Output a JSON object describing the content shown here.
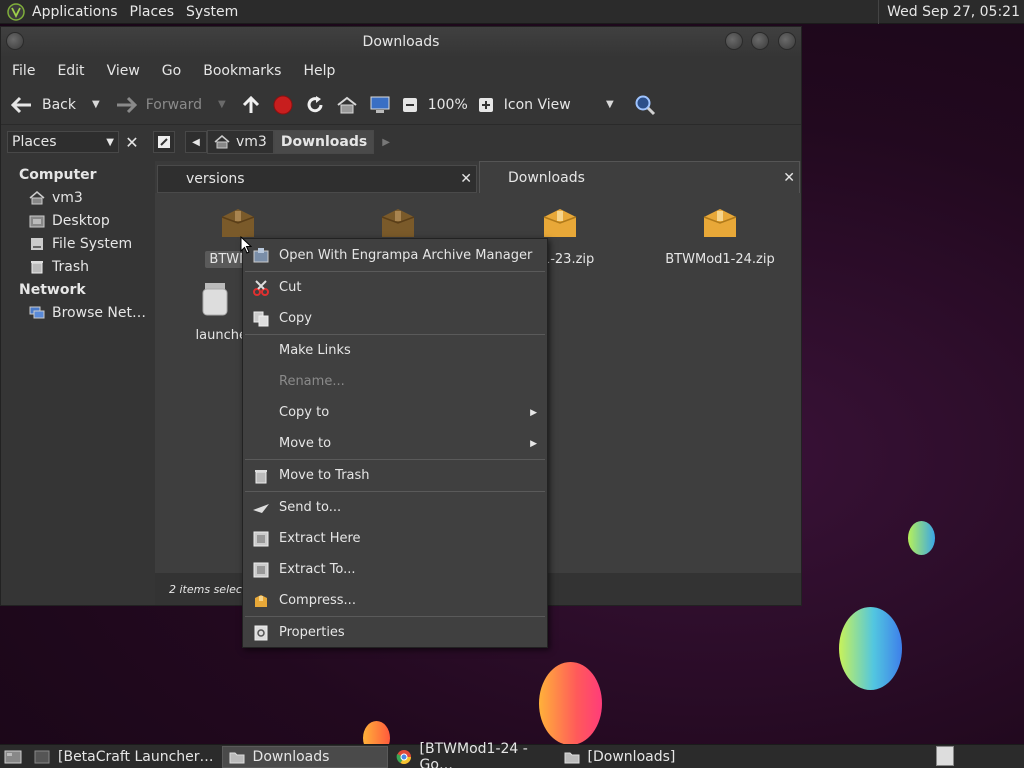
{
  "top_panel": {
    "menus": [
      "Applications",
      "Places",
      "System"
    ],
    "clock": "Wed Sep 27, 05:21"
  },
  "window": {
    "title": "Downloads",
    "menubar": [
      "File",
      "Edit",
      "View",
      "Go",
      "Bookmarks",
      "Help"
    ],
    "toolbar": {
      "back": "Back",
      "forward": "Forward",
      "zoom": "100%",
      "view_mode": "Icon View"
    },
    "location": {
      "places_label": "Places",
      "crumbs": [
        "vm3",
        "Downloads"
      ]
    },
    "sidebar": {
      "computer_header": "Computer",
      "computer_items": [
        "vm3",
        "Desktop",
        "File System",
        "Trash"
      ],
      "network_header": "Network",
      "network_items": [
        "Browse Net…"
      ]
    },
    "tabs": [
      "versions",
      "Downloads"
    ],
    "files": [
      {
        "label": "BTWMod"
      },
      {
        "label": ""
      },
      {
        "label": "od1-23.zip"
      },
      {
        "label": "BTWMod1-24.zip"
      },
      {
        "label": "launcher-1"
      }
    ],
    "status": "2 items selecte"
  },
  "context_menu": {
    "items": [
      {
        "label": "Open With Engrampa Archive Manager",
        "icon": "archive-manager-icon"
      },
      {
        "label": "Cut",
        "icon": "scissors-icon"
      },
      {
        "label": "Copy",
        "icon": "copy-icon"
      },
      {
        "label": "Make Links",
        "icon": ""
      },
      {
        "label": "Rename...",
        "icon": ""
      },
      {
        "label": "Copy to",
        "icon": ""
      },
      {
        "label": "Move to",
        "icon": ""
      },
      {
        "label": "Move to Trash",
        "icon": "trash-icon"
      },
      {
        "label": "Send to...",
        "icon": "send-icon"
      },
      {
        "label": "Extract Here",
        "icon": "extract-icon"
      },
      {
        "label": "Extract To...",
        "icon": "extract-icon"
      },
      {
        "label": "Compress...",
        "icon": "compress-icon"
      },
      {
        "label": "Properties",
        "icon": "properties-icon"
      }
    ]
  },
  "taskbar": {
    "tasks": [
      "[BetaCraft Launcher…",
      "Downloads",
      "[BTWMod1-24 - Go…",
      "[Downloads]"
    ]
  }
}
